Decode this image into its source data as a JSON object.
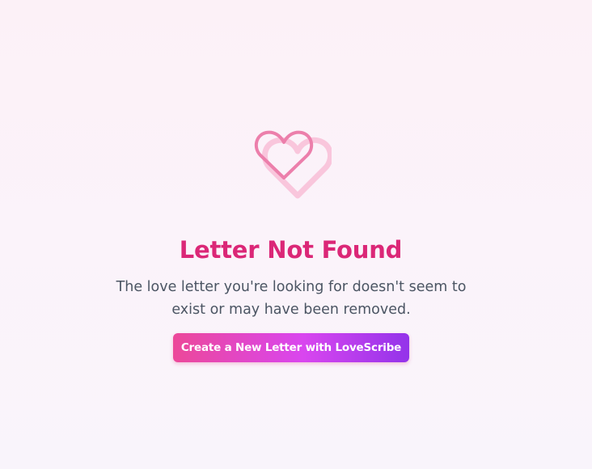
{
  "not_found": {
    "icon": "heart-icon",
    "title": "Letter Not Found",
    "message": "The love letter you're looking for doesn't seem to exist or may have been removed.",
    "cta_label": "Create a New Letter with LoveScribe"
  },
  "colors": {
    "background": "#fcf1f7",
    "title": "#db2777",
    "message": "#4b5563",
    "heart_front": "#ec7fab",
    "heart_back": "#f9c6dc",
    "button_gradient_start": "#ec4899",
    "button_gradient_end": "#9333ea",
    "button_text": "#ffffff"
  }
}
